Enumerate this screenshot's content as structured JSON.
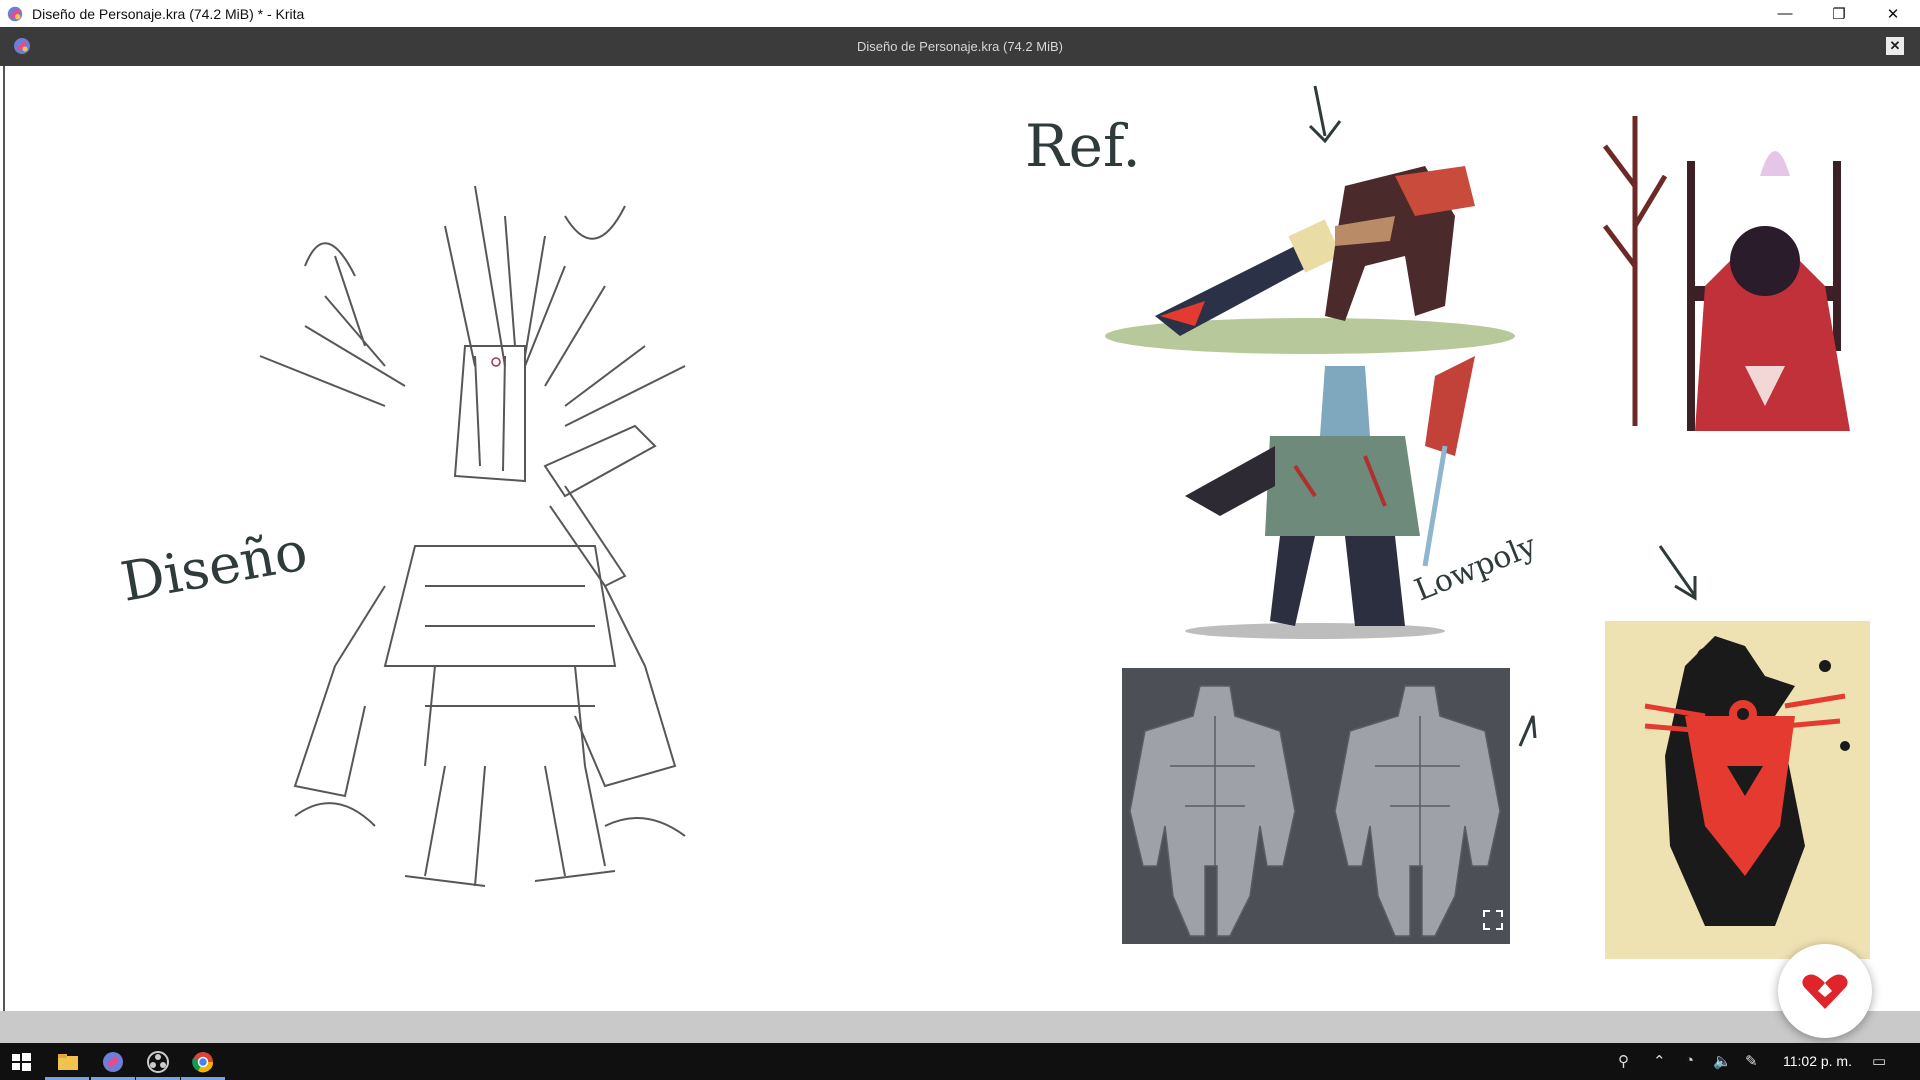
{
  "window": {
    "title": "Diseño de Personaje.kra (74.2 MiB) * - Krita",
    "minimize_glyph": "—",
    "maximize_glyph": "❐",
    "close_glyph": "✕"
  },
  "document": {
    "tab_title": "Diseño de Personaje.kra (74.2 MiB)",
    "close_glyph": "✕"
  },
  "canvas": {
    "handwritten_labels": [
      "Diseño",
      "Ref.",
      "Lowpoly"
    ]
  },
  "taskbar": {
    "clock": "11:02 p. m.",
    "apps": [
      "windows-start-icon",
      "file-explorer-icon",
      "krita-icon",
      "obs-icon",
      "chrome-icon"
    ],
    "tray": [
      "people-icon",
      "chevron-up-icon",
      "network-icon",
      "volume-icon",
      "pen-icon",
      "notification-icon"
    ]
  },
  "colors": {
    "titlebar_bg": "#ffffff",
    "doc_header_bg": "#3b3b3b",
    "taskbar_bg": "#101010",
    "accent_red": "#e53a2f",
    "poster_bg": "#efe2b2"
  }
}
